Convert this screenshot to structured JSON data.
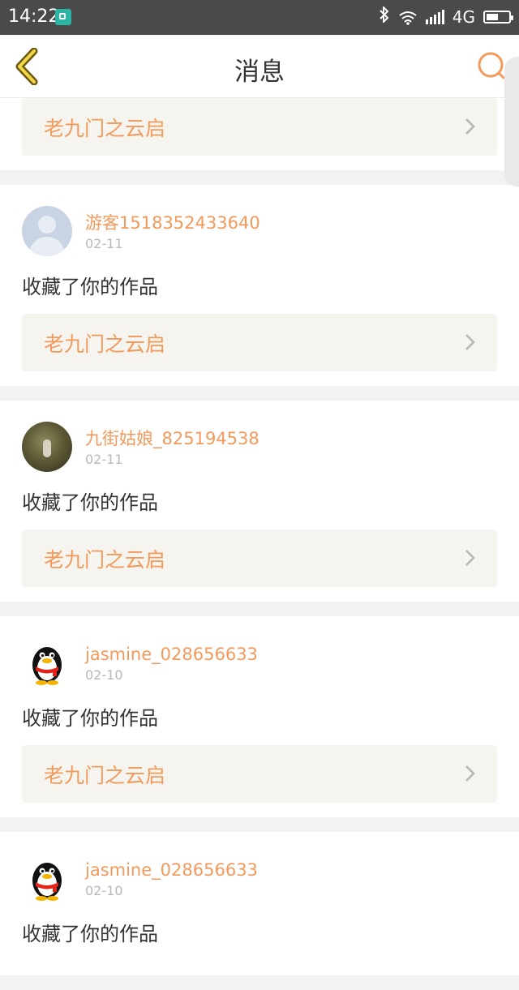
{
  "status": {
    "time": "14:22",
    "network": "4G"
  },
  "header": {
    "title": "消息"
  },
  "items": [
    {
      "user": "",
      "date": "",
      "action": "",
      "work": "老九门之云启"
    },
    {
      "user": "游客1518352433640",
      "date": "02-11",
      "action": "收藏了你的作品",
      "work": "老九门之云启"
    },
    {
      "user": "九街姑娘_825194538",
      "date": "02-11",
      "action": "收藏了你的作品",
      "work": "老九门之云启"
    },
    {
      "user": "jasmine_028656633",
      "date": "02-10",
      "action": "收藏了你的作品",
      "work": "老九门之云启"
    },
    {
      "user": "jasmine_028656633",
      "date": "02-10",
      "action": "收藏了你的作品",
      "work": ""
    }
  ],
  "colors": {
    "accent": "#f29a5c",
    "background": "#f2f2f2",
    "status_bar": "#4a4a4a"
  },
  "icons": {
    "back": "chevron-left-icon",
    "search": "search-icon",
    "chevron": "chevron-right-icon"
  }
}
